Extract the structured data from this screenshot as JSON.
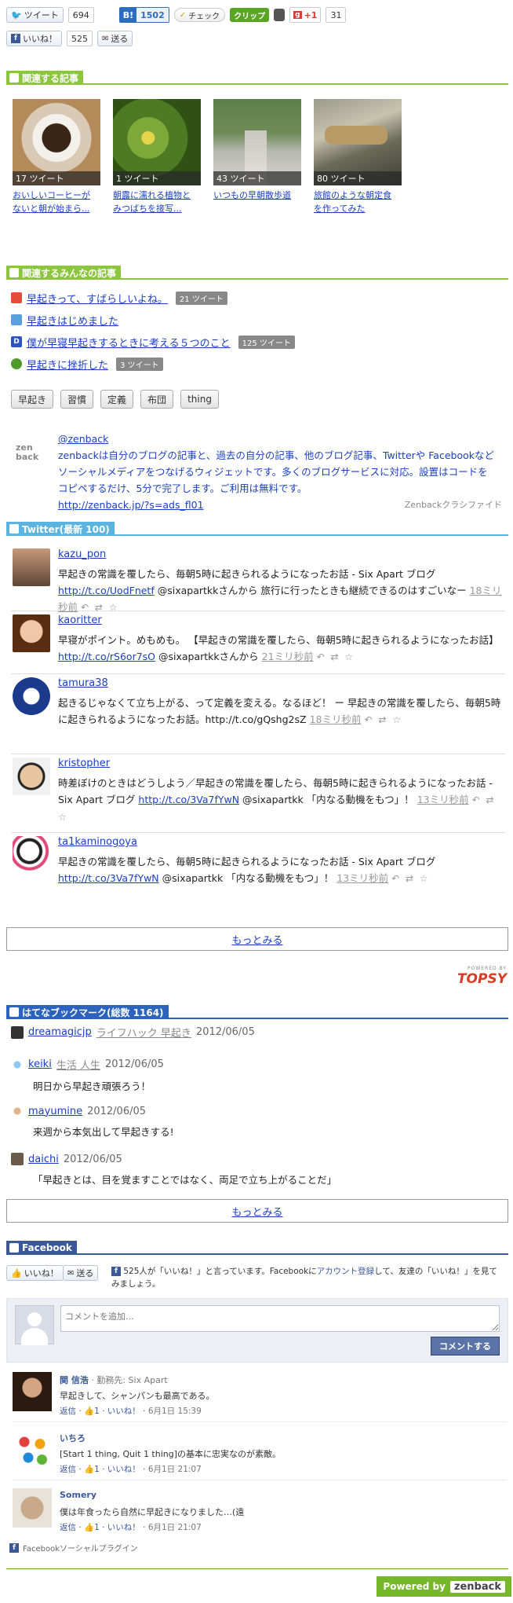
{
  "share": {
    "tweet_label": "ツイート",
    "tweet_count": "694",
    "hatena_label": "B!",
    "hatena_count": "1502",
    "check_label": "チェック",
    "clip_label": "クリップ",
    "gplus_label": "+1",
    "gplus_count": "31",
    "like_label": "いいね！",
    "like_count": "525",
    "send_label": "送る"
  },
  "related": {
    "heading": "関連する記事",
    "items": [
      {
        "tweets": "17 ツイート",
        "title_line1": "おいしいコーヒーが",
        "title_line2": "ないと朝が始まら..."
      },
      {
        "tweets": "1 ツイート",
        "title_line1": "朝露に濡れる植物と",
        "title_line2": "みつばちを接写..."
      },
      {
        "tweets": "43 ツイート",
        "title_line1": "いつもの早朝散歩道",
        "title_line2": ""
      },
      {
        "tweets": "80 ツイート",
        "title_line1": "旅館のような朝定食",
        "title_line2": "を作ってみた"
      }
    ]
  },
  "everyone": {
    "heading": "関連するみんなの記事",
    "items": [
      {
        "title": "早起きって、すばらしいよね。",
        "tweets": "21 ツイート"
      },
      {
        "title": "早起きはじめました",
        "tweets": ""
      },
      {
        "title": "僕が早寝早起きするときに考える５つのこと",
        "tweets": "125 ツイート"
      },
      {
        "title": "早起きに挫折した",
        "tweets": "3 ツイート"
      }
    ],
    "tags": [
      "早起き",
      "習慣",
      "定義",
      "布団",
      "thing"
    ]
  },
  "zenback": {
    "logo": "zen back",
    "handle": "@zenback",
    "desc": "zenbackは自分のブログの記事と、過去の自分の記事、他のブログ記事、Twitterや Facebookなどソーシャルメディアをつなげるウィジェットです。多くのブログサービスに対応。設置はコードをコピペするだけ、5分で完了します。ご利用は無料です。",
    "url": "http://zenback.jp/?s=ads_fl01",
    "classified": "Zenbackクラシファイド"
  },
  "twitter": {
    "heading": "Twitter(最新 100)",
    "tweets": [
      {
        "name": "kazu_pon",
        "text": "早起きの常識を覆したら、毎朝5時に起きられるようになったお話 - Six Apart ブログ ",
        "link": "http://t.co/UodFnetf",
        "rest": " @sixapartkkさんから 旅行に行ったときも継続できるのはすごいなー",
        "time": "18ミリ秒前"
      },
      {
        "name": "kaoritter",
        "text": "早寝がポイント。めもめも。 【早起きの常識を覆したら、毎朝5時に起きられるようになったお話】 ",
        "link": "http://t.co/rS6or7sO",
        "rest": " @sixapartkkさんから",
        "time": "21ミリ秒前"
      },
      {
        "name": "tamura38",
        "text": "起きるじゃなくて立ち上がる、って定義を変える。なるほど！ ー 早起きの常識を覆したら、毎朝5時に起きられるようになったお話。http://t.co/gQshg2sZ",
        "link": "",
        "rest": "",
        "time": "18ミリ秒前"
      },
      {
        "name": "kristopher",
        "text": "時差ぼけのときはどうしよう／早起きの常識を覆したら、毎朝5時に起きられるようになったお話 - Six Apart ブログ ",
        "link": "http://t.co/3Va7fYwN",
        "rest": " @sixapartkk 「内なる動機をもつ」！",
        "time": "13ミリ秒前"
      },
      {
        "name": "ta1kaminogoya",
        "text": "早起きの常識を覆したら、毎朝5時に起きられるようになったお話 - Six Apart ブログ ",
        "link": "http://t.co/3Va7fYwN",
        "rest": " @sixapartkk 「内なる動機をもつ」！",
        "time": "13ミリ秒前"
      }
    ],
    "more": "もっとみる",
    "powered_by": "POWERED BY",
    "topsy": "TOPSY"
  },
  "hatena": {
    "heading": "はてなブックマーク(総数 1164)",
    "items": [
      {
        "user": "dreamagicjp",
        "tags": "ライフハック 早起き",
        "date": "2012/06/05",
        "comment": ""
      },
      {
        "user": "keiki",
        "tags": "生活 人生",
        "date": "2012/06/05",
        "comment": "明日から早起き頑張ろう！"
      },
      {
        "user": "mayumine",
        "tags": "",
        "date": "2012/06/05",
        "comment": "来週から本気出して早起きする!"
      },
      {
        "user": "daichi",
        "tags": "",
        "date": "2012/06/05",
        "comment": "「早起きとは、目を覚ますことではなく、両足で立ち上がることだ」"
      }
    ],
    "more": "もっとみる"
  },
  "facebook": {
    "heading": "Facebook",
    "like_label": "いいね！",
    "send_label": "送る",
    "note_pre": "525人が「いいね！」と言っています。Facebookに",
    "note_link": "アカウント登録",
    "note_post": "して、友達の「いいね！」を見てみましょう。",
    "placeholder": "コメントを追加...",
    "post_label": "コメントする",
    "comments": [
      {
        "name": "関 信浩",
        "sub": " · 勤務先: Six Apart",
        "text": "早起きして、シャンパンも最高である。",
        "reply": "返信",
        "likes": "1",
        "like": "いいね！",
        "date": "6月1日 15:39"
      },
      {
        "name": "いちろ",
        "sub": "",
        "text": "[Start 1 thing, Quit 1 thing]の基本に忠実なのが素敵。",
        "reply": "返信",
        "likes": "1",
        "like": "いいね！",
        "date": "6月1日 21:07"
      },
      {
        "name": "Somery",
        "sub": "",
        "text": "僕は年食ったら自然に早起きになりました…(遠",
        "reply": "返信",
        "likes": "1",
        "like": "いいね！",
        "date": "6月1日 21:07"
      }
    ],
    "plugin": "Facebookソーシャルプラグイン"
  },
  "footer": {
    "powered": "Powered by",
    "brand": "zenback"
  }
}
